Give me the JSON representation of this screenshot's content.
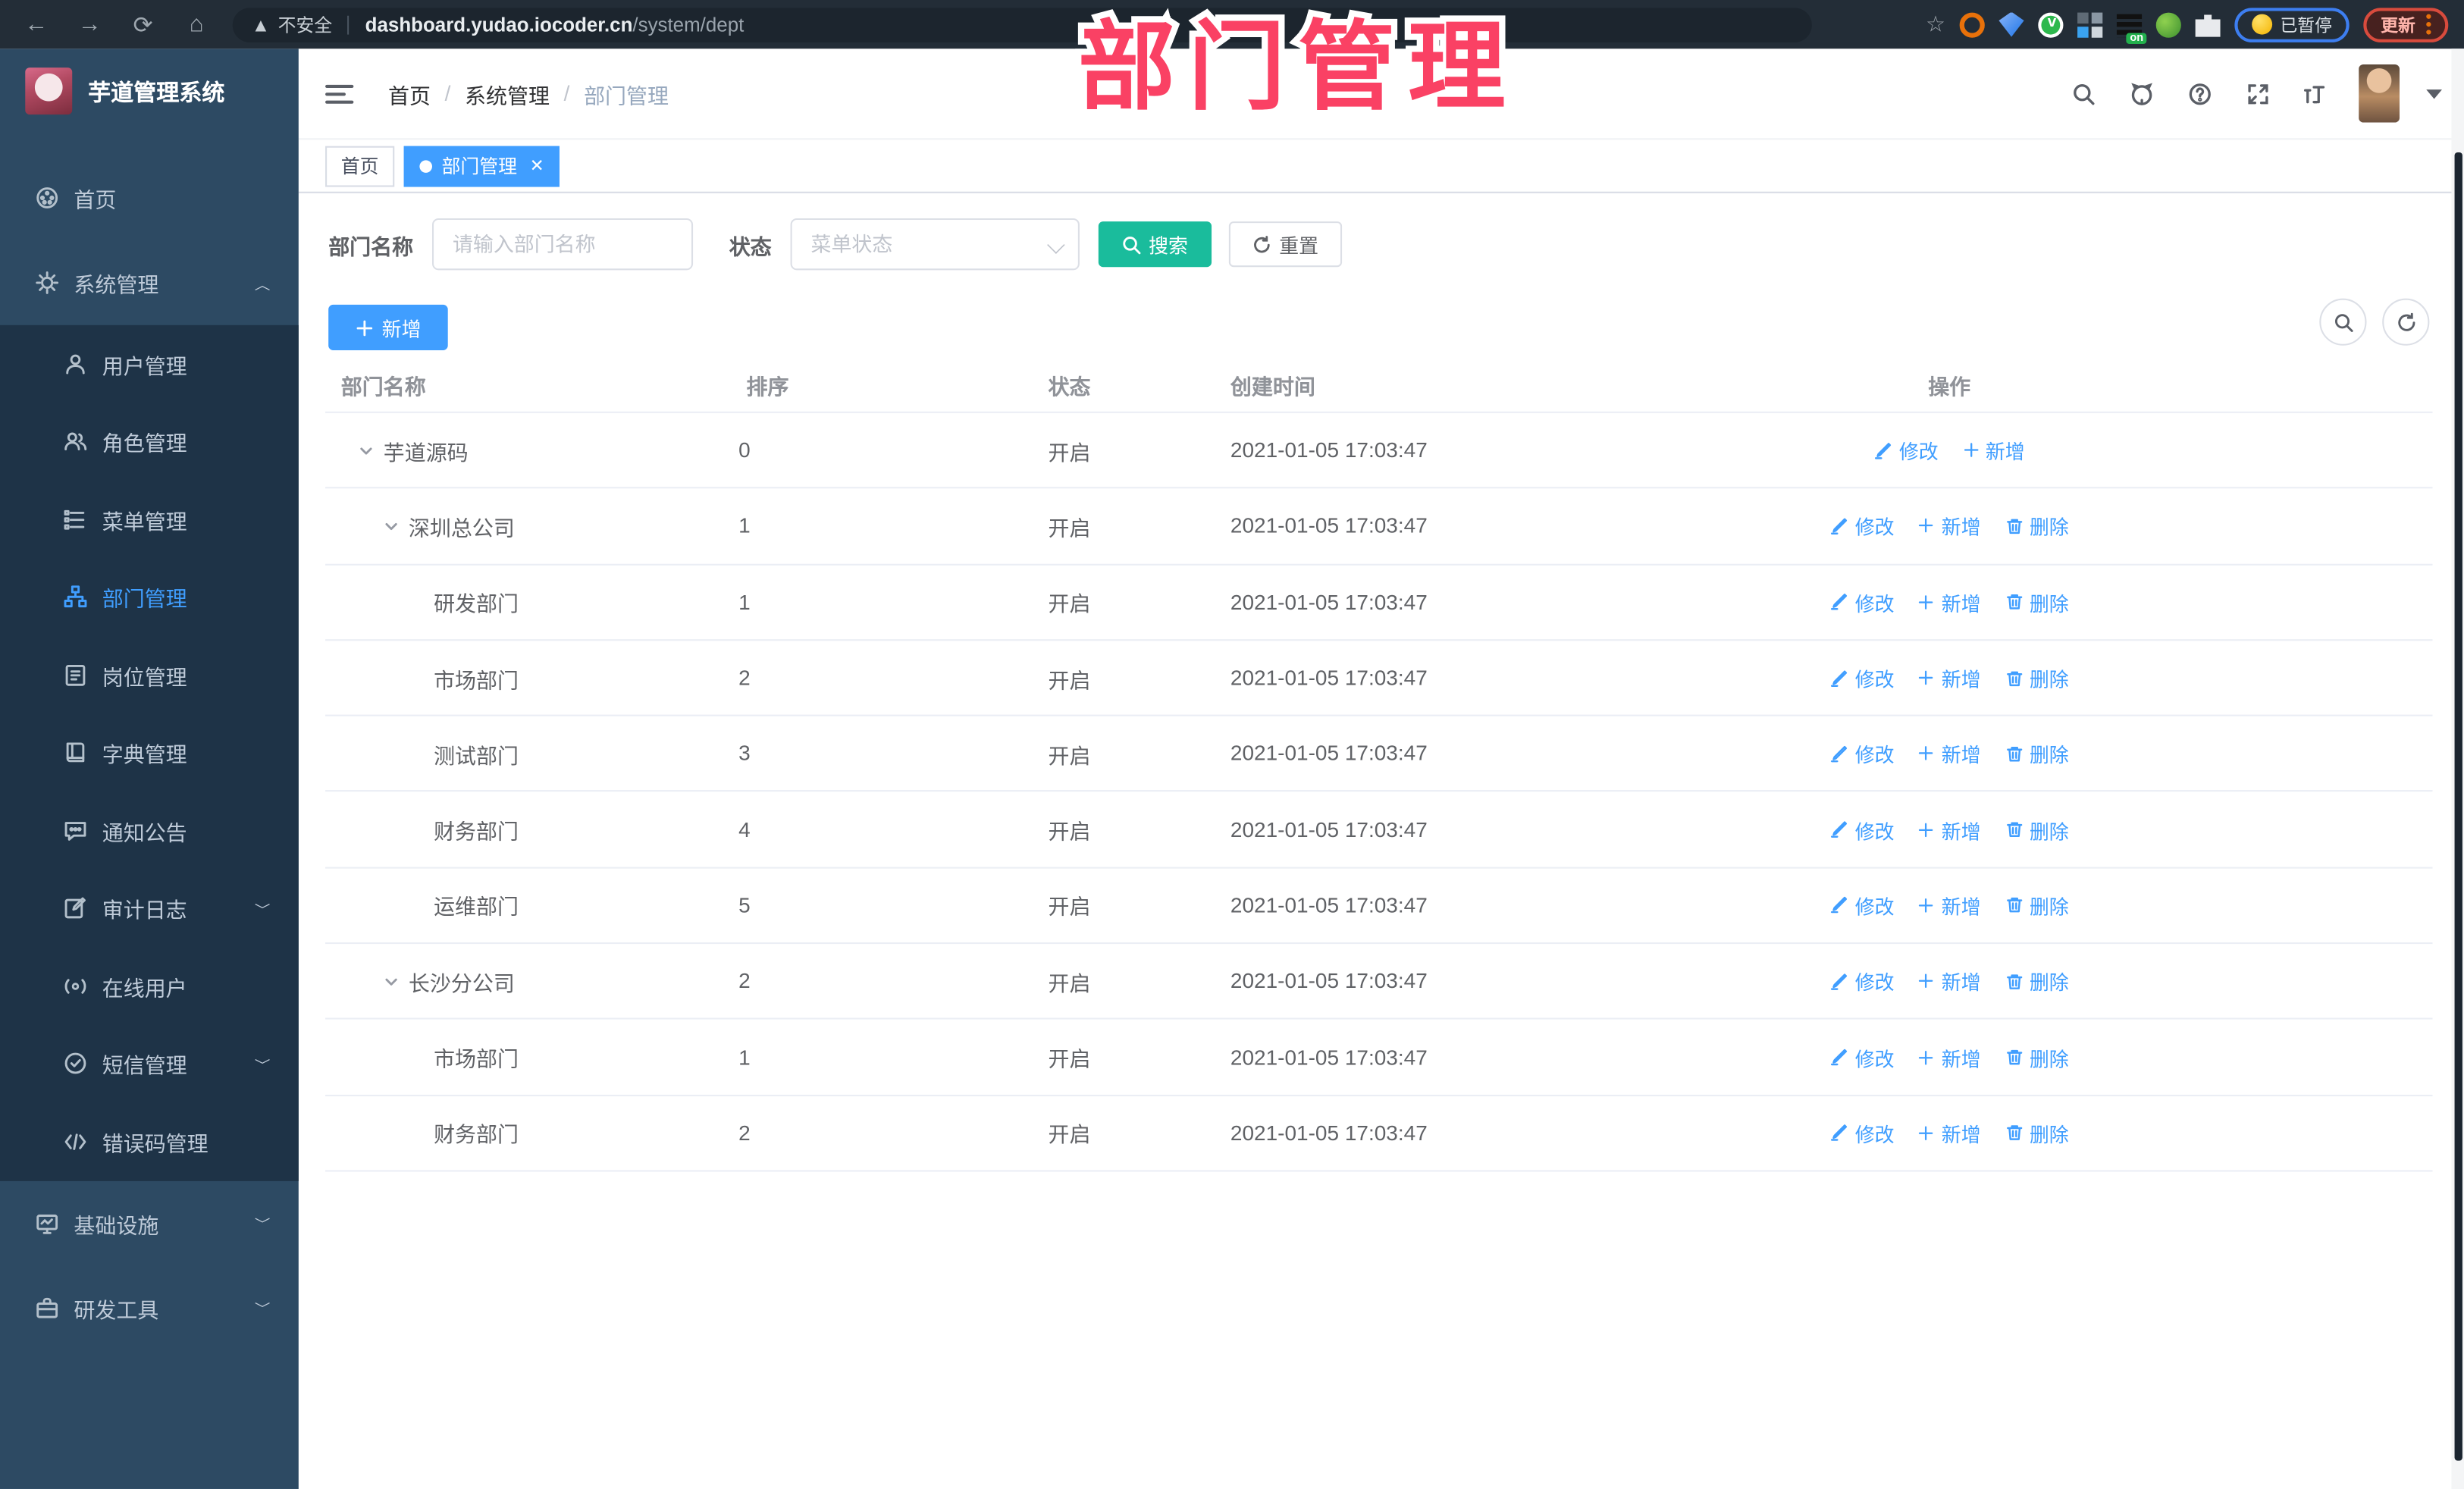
{
  "browser": {
    "security_label": "不安全",
    "url_domain": "dashboard.yudao.iocoder.cn",
    "url_path": "/system/dept",
    "paused_label": "已暂停",
    "update_label": "更新",
    "nav_icons": [
      "back-icon",
      "forward-icon",
      "reload-icon",
      "home-icon"
    ],
    "extension_icons": [
      "orange-ring-ext-icon",
      "blue-gem-ext-icon",
      "green-check-ext-icon",
      "grid-ext-icon",
      "list-on-ext-icon",
      "green-key-ext-icon",
      "puzzle-ext-icon"
    ]
  },
  "overlay_title": "部门管理",
  "sidebar": {
    "title": "芋道管理系统",
    "items": [
      {
        "icon": "dashboard-icon",
        "label": "首页",
        "level": 0
      },
      {
        "icon": "gear-icon",
        "label": "系统管理",
        "level": 0,
        "chevron": "up"
      },
      {
        "icon": "user-icon",
        "label": "用户管理",
        "level": 1,
        "group": "sub"
      },
      {
        "icon": "role-icon",
        "label": "角色管理",
        "level": 1,
        "group": "sub"
      },
      {
        "icon": "menu-tree-icon",
        "label": "菜单管理",
        "level": 1,
        "group": "sub"
      },
      {
        "icon": "dept-tree-icon",
        "label": "部门管理",
        "level": 1,
        "group": "sub",
        "active": true
      },
      {
        "icon": "post-icon",
        "label": "岗位管理",
        "level": 1,
        "group": "sub"
      },
      {
        "icon": "dict-icon",
        "label": "字典管理",
        "level": 1,
        "group": "sub"
      },
      {
        "icon": "notice-icon",
        "label": "通知公告",
        "level": 1,
        "group": "sub"
      },
      {
        "icon": "audit-log-icon",
        "label": "审计日志",
        "level": 1,
        "group": "sub",
        "chevron": "down"
      },
      {
        "icon": "online-user-icon",
        "label": "在线用户",
        "level": 1,
        "group": "sub"
      },
      {
        "icon": "sms-icon",
        "label": "短信管理",
        "level": 1,
        "group": "sub",
        "chevron": "down"
      },
      {
        "icon": "code-icon",
        "label": "错误码管理",
        "level": 1,
        "group": "sub"
      },
      {
        "icon": "infra-icon",
        "label": "基础设施",
        "level": 0,
        "chevron": "down"
      },
      {
        "icon": "tools-icon",
        "label": "研发工具",
        "level": 0,
        "chevron": "down"
      }
    ]
  },
  "header": {
    "breadcrumb": [
      "首页",
      "系统管理",
      "部门管理"
    ],
    "icons": [
      "search-icon",
      "github-icon",
      "help-icon",
      "fullscreen-icon",
      "font-size-icon"
    ]
  },
  "tabs": [
    {
      "label": "首页",
      "active": false,
      "closable": false
    },
    {
      "label": "部门管理",
      "active": true,
      "closable": true
    }
  ],
  "filters": {
    "name_label": "部门名称",
    "name_placeholder": "请输入部门名称",
    "status_label": "状态",
    "status_placeholder": "菜单状态",
    "search_label": "搜索",
    "reset_label": "重置"
  },
  "toolbar": {
    "add_label": "新增"
  },
  "table": {
    "headers": [
      "部门名称",
      "排序",
      "状态",
      "创建时间",
      "操作"
    ],
    "rows": [
      {
        "name": "芋道源码",
        "level": 0,
        "expandable": true,
        "sort": "0",
        "status": "开启",
        "created": "2021-01-05 17:03:47",
        "actions": [
          {
            "label": "修改",
            "icon": "edit-pencil-icon"
          },
          {
            "label": "新增",
            "icon": "plus-icon"
          }
        ]
      },
      {
        "name": "深圳总公司",
        "level": 1,
        "expandable": true,
        "sort": "1",
        "status": "开启",
        "created": "2021-01-05 17:03:47",
        "actions": [
          {
            "label": "修改",
            "icon": "edit-pencil-icon"
          },
          {
            "label": "新增",
            "icon": "plus-icon"
          },
          {
            "label": "删除",
            "icon": "trash-icon"
          }
        ]
      },
      {
        "name": "研发部门",
        "level": 2,
        "expandable": false,
        "sort": "1",
        "status": "开启",
        "created": "2021-01-05 17:03:47",
        "actions": [
          {
            "label": "修改",
            "icon": "edit-pencil-icon"
          },
          {
            "label": "新增",
            "icon": "plus-icon"
          },
          {
            "label": "删除",
            "icon": "trash-icon"
          }
        ]
      },
      {
        "name": "市场部门",
        "level": 2,
        "expandable": false,
        "sort": "2",
        "status": "开启",
        "created": "2021-01-05 17:03:47",
        "actions": [
          {
            "label": "修改",
            "icon": "edit-pencil-icon"
          },
          {
            "label": "新增",
            "icon": "plus-icon"
          },
          {
            "label": "删除",
            "icon": "trash-icon"
          }
        ]
      },
      {
        "name": "测试部门",
        "level": 2,
        "expandable": false,
        "sort": "3",
        "status": "开启",
        "created": "2021-01-05 17:03:47",
        "actions": [
          {
            "label": "修改",
            "icon": "edit-pencil-icon"
          },
          {
            "label": "新增",
            "icon": "plus-icon"
          },
          {
            "label": "删除",
            "icon": "trash-icon"
          }
        ]
      },
      {
        "name": "财务部门",
        "level": 2,
        "expandable": false,
        "sort": "4",
        "status": "开启",
        "created": "2021-01-05 17:03:47",
        "actions": [
          {
            "label": "修改",
            "icon": "edit-pencil-icon"
          },
          {
            "label": "新增",
            "icon": "plus-icon"
          },
          {
            "label": "删除",
            "icon": "trash-icon"
          }
        ]
      },
      {
        "name": "运维部门",
        "level": 2,
        "expandable": false,
        "sort": "5",
        "status": "开启",
        "created": "2021-01-05 17:03:47",
        "actions": [
          {
            "label": "修改",
            "icon": "edit-pencil-icon"
          },
          {
            "label": "新增",
            "icon": "plus-icon"
          },
          {
            "label": "删除",
            "icon": "trash-icon"
          }
        ]
      },
      {
        "name": "长沙分公司",
        "level": 1,
        "expandable": true,
        "sort": "2",
        "status": "开启",
        "created": "2021-01-05 17:03:47",
        "actions": [
          {
            "label": "修改",
            "icon": "edit-pencil-icon"
          },
          {
            "label": "新增",
            "icon": "plus-icon"
          },
          {
            "label": "删除",
            "icon": "trash-icon"
          }
        ]
      },
      {
        "name": "市场部门",
        "level": 2,
        "expandable": false,
        "sort": "1",
        "status": "开启",
        "created": "2021-01-05 17:03:47",
        "actions": [
          {
            "label": "修改",
            "icon": "edit-pencil-icon"
          },
          {
            "label": "新增",
            "icon": "plus-icon"
          },
          {
            "label": "删除",
            "icon": "trash-icon"
          }
        ]
      },
      {
        "name": "财务部门",
        "level": 2,
        "expandable": false,
        "sort": "2",
        "status": "开启",
        "created": "2021-01-05 17:03:47",
        "actions": [
          {
            "label": "修改",
            "icon": "edit-pencil-icon"
          },
          {
            "label": "新增",
            "icon": "plus-icon"
          },
          {
            "label": "删除",
            "icon": "trash-icon"
          }
        ]
      }
    ]
  }
}
